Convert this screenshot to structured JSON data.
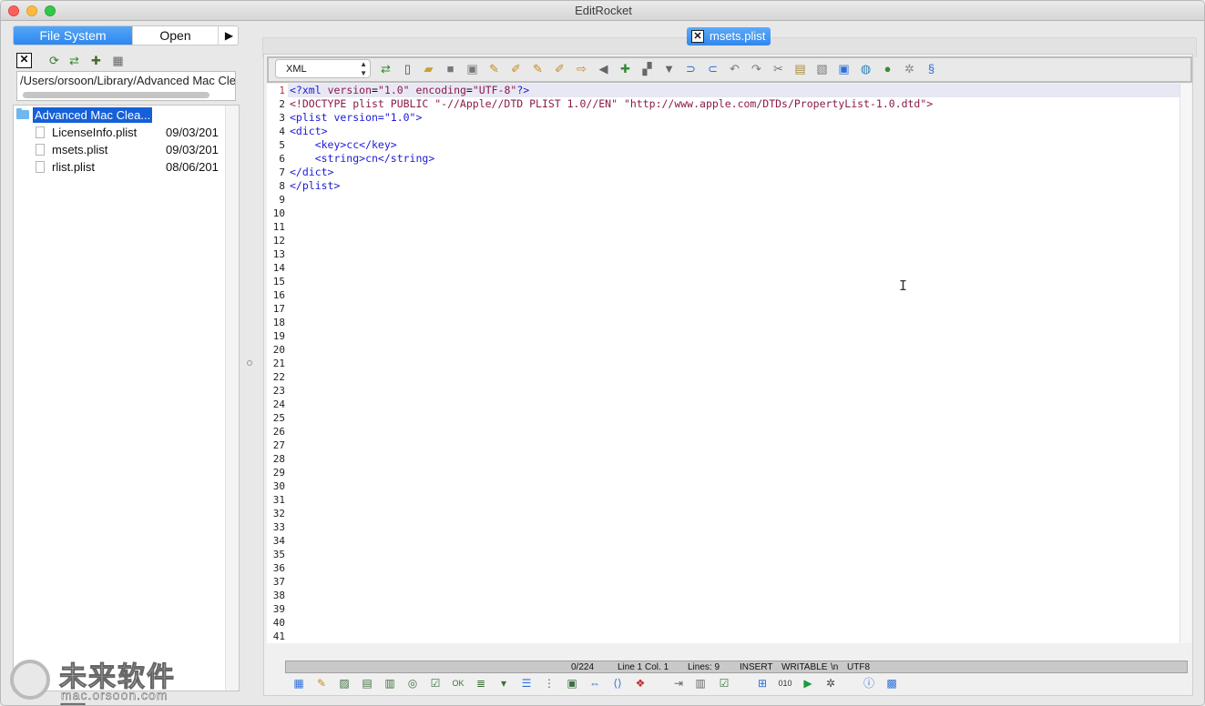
{
  "window": {
    "title": "EditRocket"
  },
  "left_panel": {
    "segments": [
      "File System",
      "Open",
      "▶"
    ],
    "path": "/Users/orsoon/Library/Advanced Mac Cle",
    "tree": {
      "root": "Advanced Mac Clea...",
      "files": [
        {
          "name": "LicenseInfo.plist",
          "date": "09/03/201"
        },
        {
          "name": "msets.plist",
          "date": "09/03/201"
        },
        {
          "name": "rlist.plist",
          "date": "08/06/201"
        }
      ]
    }
  },
  "editor": {
    "tab_label": "msets.plist",
    "language": "XML",
    "line_numbers": [
      "1",
      "2",
      "3",
      "4",
      "5",
      "6",
      "7",
      "8",
      "9",
      "10",
      "11",
      "12",
      "13",
      "14",
      "15",
      "16",
      "17",
      "18",
      "19",
      "20",
      "21",
      "22",
      "23",
      "24",
      "25",
      "26",
      "27",
      "28",
      "29",
      "30",
      "31",
      "32",
      "33",
      "34",
      "35",
      "36",
      "37",
      "38",
      "39",
      "40",
      "41"
    ],
    "code_lines": [
      "<?xml version=\"1.0\" encoding=\"UTF-8\"?>",
      "<!DOCTYPE plist PUBLIC \"-//Apple//DTD PLIST 1.0//EN\" \"http://www.apple.com/DTDs/PropertyList-1.0.dtd\">",
      "<plist version=\"1.0\">",
      "<dict>",
      "    <key>cc</key>",
      "    <string>cn</string>",
      "</dict>",
      "</plist>"
    ]
  },
  "status": {
    "position": "0/224",
    "line_col": "Line 1 Col. 1",
    "lines": "Lines: 9",
    "mode": "INSERT",
    "writable": "WRITABLE",
    "newline": "\\n",
    "encoding": "UTF8"
  },
  "watermark": {
    "text": "未来软件园",
    "url": "mac.orsoon.com"
  },
  "colors": {
    "selection": "#1560d8",
    "tab_active": "#2f87ee",
    "tag": "#1a1ad8",
    "attr": "#8a1a45"
  }
}
